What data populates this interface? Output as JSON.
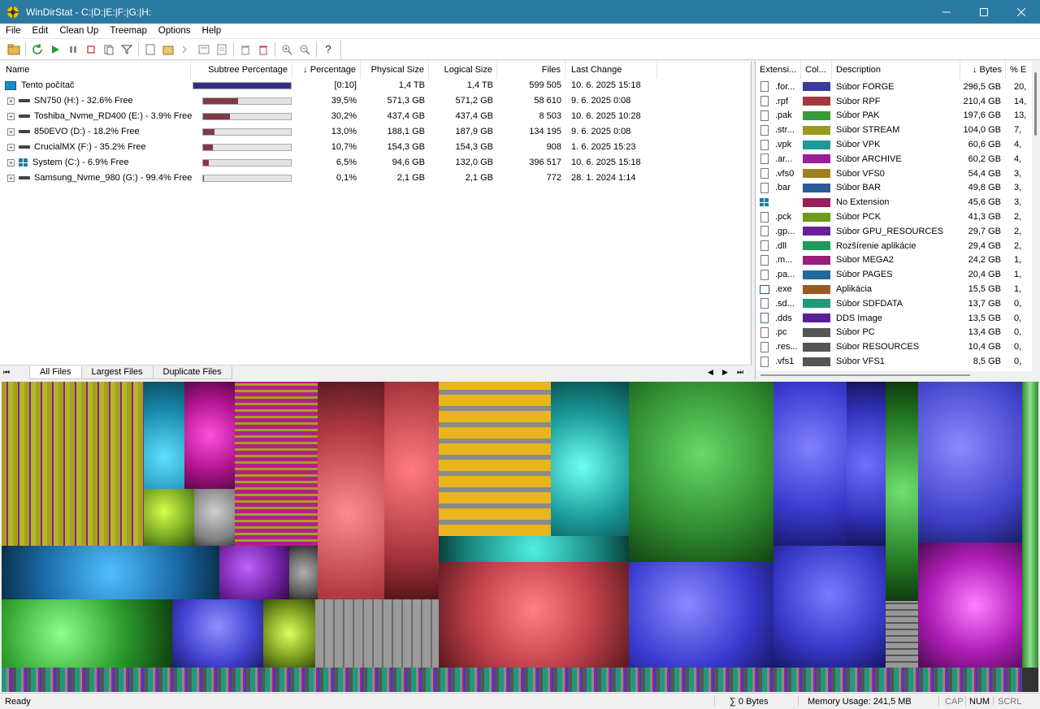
{
  "window": {
    "title": "WinDirStat - C:|D:|E:|F:|G:|H:"
  },
  "menu": [
    "File",
    "Edit",
    "Clean Up",
    "Treemap",
    "Options",
    "Help"
  ],
  "toolbar": [
    "open-icon",
    "refresh-icon",
    "play-icon",
    "pause-icon",
    "stop-icon",
    "copy-path-icon",
    "filter-icon",
    "new-file-icon",
    "explorer-icon",
    "cmd-icon",
    "properties-icon",
    "delete-bin-icon",
    "delete-icon",
    "zoom-in-icon",
    "zoom-out-icon",
    "help-icon"
  ],
  "tree": {
    "columns": {
      "name": "Name",
      "subtree": "Subtree Percentage",
      "percentage": "↓ Percentage",
      "physical": "Physical Size",
      "logical": "Logical Size",
      "files": "Files",
      "last_change": "Last Change"
    },
    "root": {
      "name": "Tento počítač",
      "percentage": "[0:10]",
      "physical": "1,4 TB",
      "logical": "1,4 TB",
      "files": "599 505",
      "last_change": "10. 6. 2025  15:18",
      "subtree": 1.0
    },
    "drives": [
      {
        "name": "SN750 (H:) - 32.6% Free",
        "icon": "drive-icon",
        "percentage": "39,5%",
        "physical": "571,3 GB",
        "logical": "571,2 GB",
        "files": "58 610",
        "last_change": "9. 6. 2025  0:08",
        "subtree": 0.395
      },
      {
        "name": "Toshiba_Nvme_RD400 (E:) - 3.9% Free",
        "icon": "drive-icon",
        "percentage": "30,2%",
        "physical": "437,4 GB",
        "logical": "437,4 GB",
        "files": "8 503",
        "last_change": "10. 6. 2025  10:28",
        "subtree": 0.302
      },
      {
        "name": "850EVO (D:) - 18.2% Free",
        "icon": "drive-icon",
        "percentage": "13,0%",
        "physical": "188,1 GB",
        "logical": "187,9 GB",
        "files": "134 195",
        "last_change": "9. 6. 2025  0:08",
        "subtree": 0.13
      },
      {
        "name": "CrucialMX (F:) - 35.2% Free",
        "icon": "drive-icon",
        "percentage": "10,7%",
        "physical": "154,3 GB",
        "logical": "154,3 GB",
        "files": "908",
        "last_change": "1. 6. 2025  15:23",
        "subtree": 0.107
      },
      {
        "name": "System (C:) - 6.9% Free",
        "icon": "windows-drive-icon",
        "percentage": "6,5%",
        "physical": "94,6 GB",
        "logical": "132,0 GB",
        "files": "396 517",
        "last_change": "10. 6. 2025  15:18",
        "subtree": 0.065
      },
      {
        "name": "Samsung_Nvme_980 (G:) - 99.4% Free",
        "icon": "drive-icon",
        "percentage": "0,1%",
        "physical": "2,1 GB",
        "logical": "2,1 GB",
        "files": "772",
        "last_change": "28. 1. 2024  1:14",
        "subtree": 0.001
      }
    ]
  },
  "tabs": [
    "All Files",
    "Largest Files",
    "Duplicate Files"
  ],
  "extensions": {
    "columns": {
      "ext": "Extensi...",
      "color": "Col...",
      "desc": "Description",
      "bytes": "↓ Bytes",
      "pct": "% E"
    },
    "rows": [
      {
        "ext": ".for...",
        "color": "#3b3b9e",
        "desc": "Súbor FORGE",
        "bytes": "296,5 GB",
        "pct": "20,"
      },
      {
        "ext": ".rpf",
        "color": "#a13a3e",
        "desc": "Súbor RPF",
        "bytes": "210,4 GB",
        "pct": "14,"
      },
      {
        "ext": ".pak",
        "color": "#3a9a3a",
        "desc": "Súbor PAK",
        "bytes": "197,6 GB",
        "pct": "13,"
      },
      {
        "ext": ".str...",
        "color": "#9a9a1e",
        "desc": "Súbor STREAM",
        "bytes": "104,0 GB",
        "pct": "7,"
      },
      {
        "ext": ".vpk",
        "color": "#1e9a9a",
        "desc": "Súbor VPK",
        "bytes": "60,6 GB",
        "pct": "4,"
      },
      {
        "ext": ".ar...",
        "color": "#9a1e9a",
        "desc": "Súbor ARCHIVE",
        "bytes": "60,2 GB",
        "pct": "4,"
      },
      {
        "ext": ".vfs0",
        "color": "#a0801e",
        "desc": "Súbor VFS0",
        "bytes": "54,4 GB",
        "pct": "3,"
      },
      {
        "ext": ".bar",
        "color": "#2a5a9a",
        "desc": "Súbor BAR",
        "bytes": "49,8 GB",
        "pct": "3,"
      },
      {
        "ext": "",
        "color": "#9a1e5a",
        "desc": "No Extension",
        "bytes": "45,6 GB",
        "pct": "3,"
      },
      {
        "ext": ".pck",
        "color": "#6a9a1e",
        "desc": "Súbor PCK",
        "bytes": "41,3 GB",
        "pct": "2,"
      },
      {
        "ext": ".gp...",
        "color": "#6a1e9a",
        "desc": "Súbor GPU_RESOURCES",
        "bytes": "29,7 GB",
        "pct": "2,"
      },
      {
        "ext": ".dll",
        "color": "#1e9a5a",
        "desc": "Rozšírenie aplikácie",
        "bytes": "29,4 GB",
        "pct": "2,"
      },
      {
        "ext": ".m...",
        "color": "#9a1e7a",
        "desc": "Súbor MEGA2",
        "bytes": "24,2 GB",
        "pct": "1,"
      },
      {
        "ext": ".pa...",
        "color": "#1e6a9a",
        "desc": "Súbor PAGES",
        "bytes": "20,4 GB",
        "pct": "1,"
      },
      {
        "ext": ".exe",
        "color": "#9a5a1e",
        "desc": "Aplikácia",
        "bytes": "15,5 GB",
        "pct": "1,"
      },
      {
        "ext": ".sd...",
        "color": "#1e9a7a",
        "desc": "Súbor SDFDATA",
        "bytes": "13,7 GB",
        "pct": "0,"
      },
      {
        "ext": ".dds",
        "color": "#5a1e9a",
        "desc": "DDS Image",
        "bytes": "13,5 GB",
        "pct": "0,"
      },
      {
        "ext": ".pc",
        "color": "#555555",
        "desc": "Súbor PC",
        "bytes": "13,4 GB",
        "pct": "0,"
      },
      {
        "ext": ".res...",
        "color": "#555555",
        "desc": "Súbor RESOURCES",
        "bytes": "10,4 GB",
        "pct": "0,"
      },
      {
        "ext": ".vfs1",
        "color": "#555555",
        "desc": "Súbor VFS1",
        "bytes": "8,5 GB",
        "pct": "0,"
      }
    ]
  },
  "status": {
    "ready": "Ready",
    "selection": "∑ 0 Bytes",
    "memory": "Memory Usage: 241,5 MB",
    "cap": "CAP",
    "num": "NUM",
    "scrl": "SCRL"
  }
}
